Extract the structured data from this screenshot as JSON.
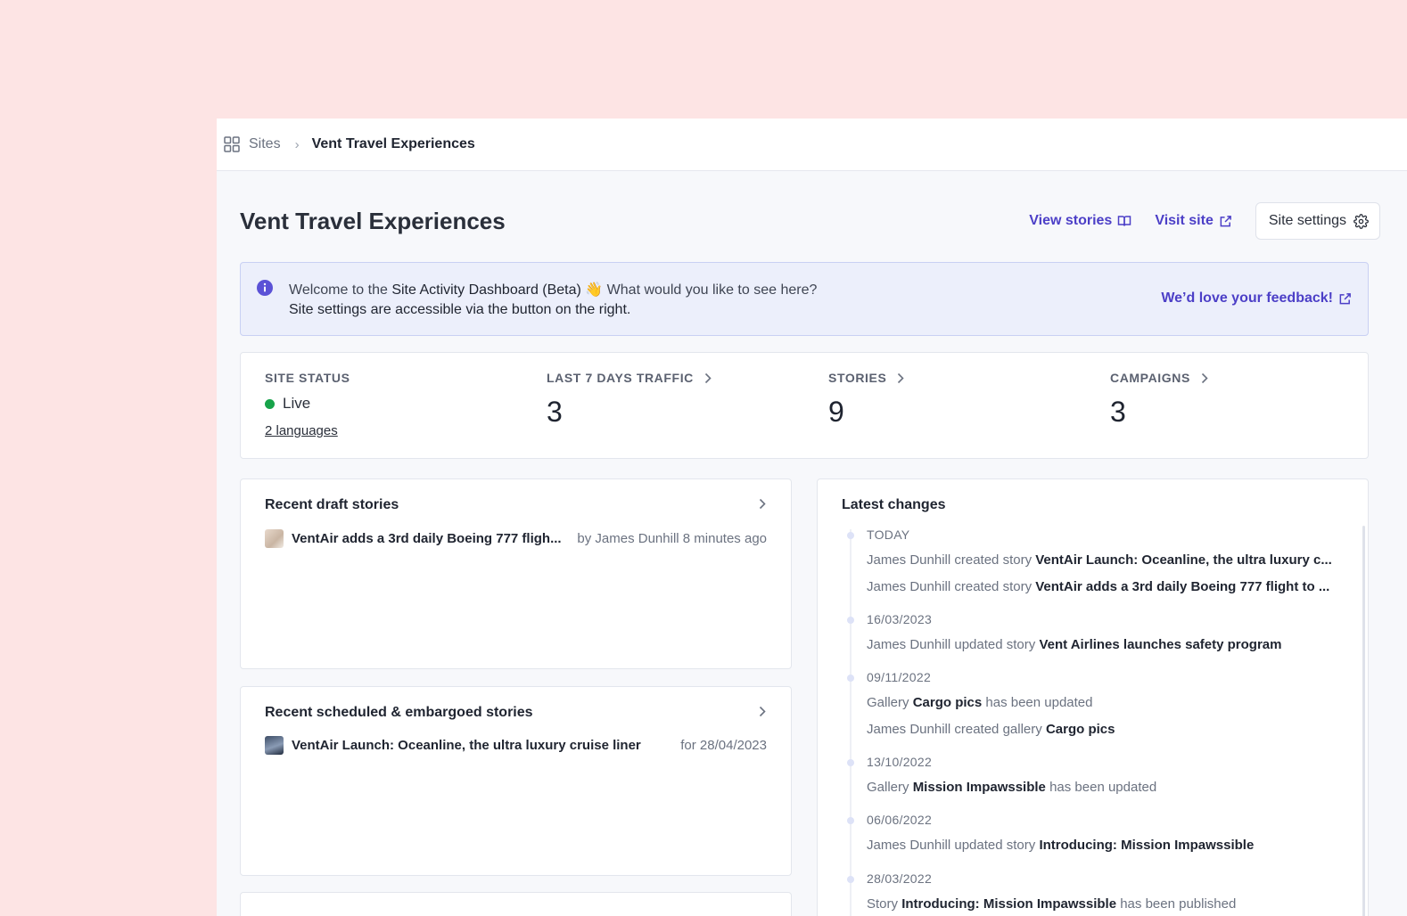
{
  "breadcrumb": {
    "root": "Sites",
    "current": "Vent Travel Experiences"
  },
  "header": {
    "title": "Vent Travel Experiences",
    "view_stories": "View stories",
    "visit_site": "Visit site",
    "site_settings": "Site settings"
  },
  "banner": {
    "line1_prefix": "Welcome to the ",
    "line1_bold": "Site Activity Dashboard (Beta)",
    "line1_emoji": "👋",
    "line1_suffix": " What would you like to see here?",
    "line2": "Site settings are accessible via the button on the right.",
    "feedback": "We’d love your feedback!"
  },
  "stats": {
    "status_label": "SITE STATUS",
    "status_value": "Live",
    "languages": "2 languages",
    "traffic_label": "LAST 7 DAYS TRAFFIC",
    "traffic_value": "3",
    "stories_label": "STORIES",
    "stories_value": "9",
    "campaigns_label": "CAMPAIGNS",
    "campaigns_value": "3"
  },
  "drafts": {
    "title": "Recent draft stories",
    "items": [
      {
        "title": "VentAir adds a 3rd daily Boeing 777 fligh...",
        "meta": "by James Dunhill 8 minutes ago"
      }
    ]
  },
  "scheduled": {
    "title": "Recent scheduled & embargoed stories",
    "items": [
      {
        "title": "VentAir Launch: Oceanline, the ultra luxury cruise liner",
        "meta": "for 28/04/2023"
      }
    ]
  },
  "changes": {
    "title": "Latest changes",
    "groups": [
      {
        "date": "TODAY",
        "items": [
          {
            "pre": "James Dunhill created story ",
            "bold": "VentAir Launch: Oceanline, the ultra luxury c...",
            "post": ""
          },
          {
            "pre": "James Dunhill created story ",
            "bold": "VentAir adds a 3rd daily Boeing 777 flight to ...",
            "post": ""
          }
        ]
      },
      {
        "date": "16/03/2023",
        "items": [
          {
            "pre": "James Dunhill updated story ",
            "bold": "Vent Airlines launches safety program",
            "post": ""
          }
        ]
      },
      {
        "date": "09/11/2022",
        "items": [
          {
            "pre": "Gallery ",
            "bold": "Cargo pics",
            "post": " has been updated"
          },
          {
            "pre": "James Dunhill created gallery ",
            "bold": "Cargo pics",
            "post": ""
          }
        ]
      },
      {
        "date": "13/10/2022",
        "items": [
          {
            "pre": "Gallery ",
            "bold": "Mission Impawssible",
            "post": " has been updated"
          }
        ]
      },
      {
        "date": "06/06/2022",
        "items": [
          {
            "pre": "James Dunhill updated story ",
            "bold": "Introducing: Mission Impawssible",
            "post": ""
          }
        ]
      },
      {
        "date": "28/03/2022",
        "items": [
          {
            "pre": "Story ",
            "bold": "Introducing: Mission Impawssible",
            "post": " has been published"
          }
        ]
      }
    ]
  },
  "colors": {
    "accent": "#4c3fc7",
    "live": "#17a34a",
    "background": "#fde4e4"
  }
}
